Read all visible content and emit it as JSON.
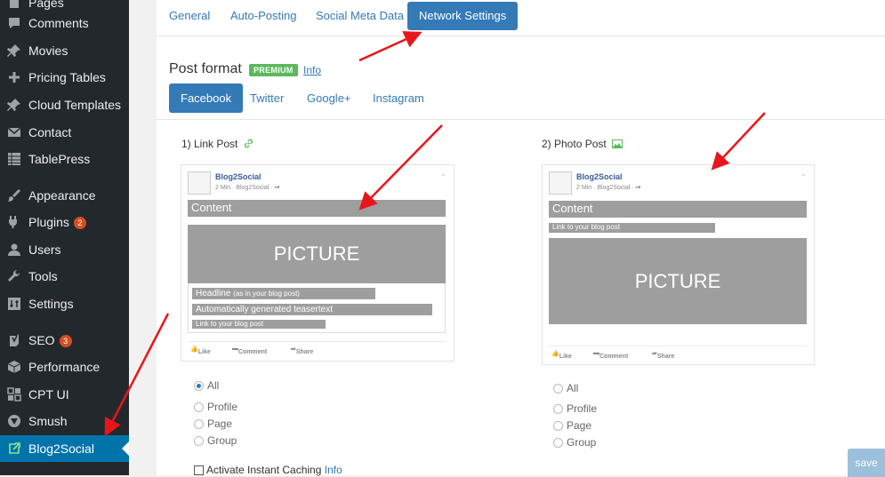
{
  "sidebar": {
    "items": [
      {
        "label": "Pages",
        "icon": "pages-icon",
        "badge": ""
      },
      {
        "label": "Comments",
        "icon": "comments-icon",
        "badge": ""
      },
      {
        "label": "Movies",
        "icon": "pin-icon",
        "badge": ""
      },
      {
        "label": "Pricing Tables",
        "icon": "plus-icon",
        "badge": ""
      },
      {
        "label": "Cloud Templates",
        "icon": "pin-icon",
        "badge": ""
      },
      {
        "label": "Contact",
        "icon": "envelope-icon",
        "badge": ""
      },
      {
        "label": "TablePress",
        "icon": "table-icon",
        "badge": ""
      },
      {
        "label": "Appearance",
        "icon": "brush-icon",
        "badge": ""
      },
      {
        "label": "Plugins",
        "icon": "plugin-icon",
        "badge": "2"
      },
      {
        "label": "Users",
        "icon": "user-icon",
        "badge": ""
      },
      {
        "label": "Tools",
        "icon": "wrench-icon",
        "badge": ""
      },
      {
        "label": "Settings",
        "icon": "settings-icon",
        "badge": ""
      },
      {
        "label": "SEO",
        "icon": "yoast-icon",
        "badge": "3"
      },
      {
        "label": "Performance",
        "icon": "performance-icon",
        "badge": ""
      },
      {
        "label": "CPT UI",
        "icon": "grid-icon",
        "badge": ""
      },
      {
        "label": "Smush",
        "icon": "smush-icon",
        "badge": ""
      },
      {
        "label": "Blog2Social",
        "icon": "blog2social-icon",
        "badge": ""
      }
    ],
    "active": "Blog2Social"
  },
  "tabs": [
    "General",
    "Auto-Posting",
    "Social Meta Data",
    "Network Settings"
  ],
  "active_tab": "Network Settings",
  "post_format": {
    "title": "Post format",
    "premium_badge": "PREMIUM",
    "info_link": "Info"
  },
  "network_tabs": [
    "Facebook",
    "Twitter",
    "Google+",
    "Instagram"
  ],
  "active_network": "Facebook",
  "link_post": {
    "title": "1) Link Post",
    "author": "Blog2Social",
    "meta": "2 Min · Blog2Social · ",
    "content": "Content",
    "picture": "PICTURE",
    "headline": "Headline",
    "headline_note": "(as in your blog post)",
    "teaser": "Automatically generated teasertext",
    "link": "Link to your blog post",
    "actions": [
      "Like",
      "Comment",
      "Share"
    ]
  },
  "photo_post": {
    "title": "2) Photo Post",
    "author": "Blog2Social",
    "meta": "2 Min · Blog2Social · ",
    "content": "Content",
    "link": "Link to your blog post",
    "picture": "PICTURE",
    "actions": [
      "Like",
      "Comment",
      "Share"
    ]
  },
  "link_options": [
    {
      "label": "All",
      "selected": true
    },
    {
      "label": "Profile",
      "selected": false
    },
    {
      "label": "Page",
      "selected": false
    },
    {
      "label": "Group",
      "selected": false
    }
  ],
  "photo_options": [
    {
      "label": "All",
      "selected": false
    },
    {
      "label": "Profile",
      "selected": false
    },
    {
      "label": "Page",
      "selected": false
    },
    {
      "label": "Group",
      "selected": false
    }
  ],
  "instant_caching": {
    "label": "Activate Instant Caching",
    "info": "Info"
  },
  "save_label": "save",
  "colors": {
    "sidebar_bg": "#23282d",
    "accent": "#337ab7",
    "active_menu": "#0073aa",
    "premium": "#5cb85c",
    "arrow": "#e8161b",
    "placeholder_gray": "#9e9e9e"
  }
}
